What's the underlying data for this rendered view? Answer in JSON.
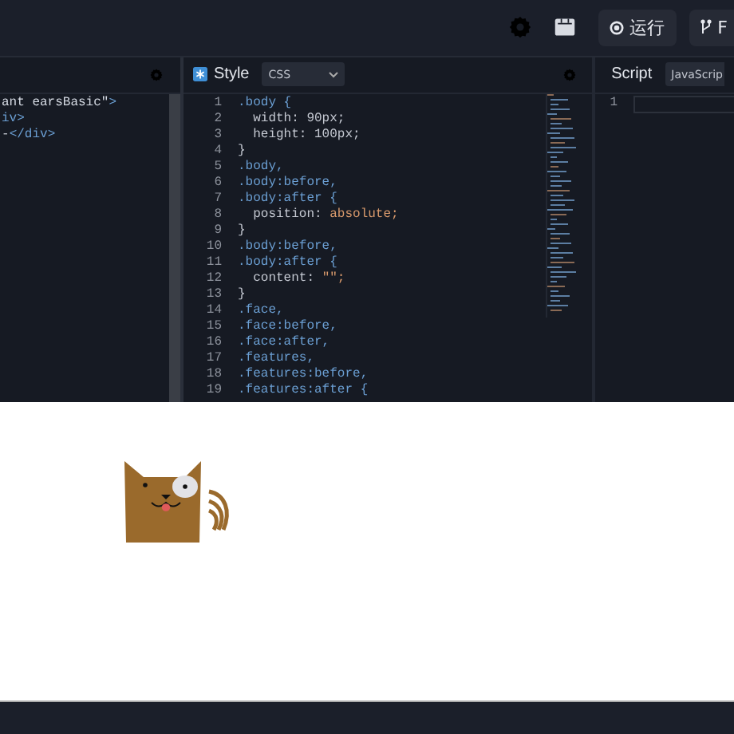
{
  "toolbar": {
    "run_button": "运行",
    "fork_button": "F"
  },
  "html_panel": {
    "lines": [
      {
        "segments": [
          {
            "text": "ant earsBasic\"",
            "kind": "string"
          },
          {
            "text": ">",
            "kind": "tag"
          }
        ]
      },
      {
        "segments": [
          {
            "text": "iv>",
            "kind": "tag"
          }
        ]
      },
      {
        "segments": [
          {
            "text": "-",
            "kind": "plain"
          },
          {
            "text": "</div>",
            "kind": "tag"
          }
        ]
      }
    ]
  },
  "style_panel": {
    "title": "Style",
    "language": "CSS",
    "lines": [
      {
        "number": "1",
        "segments": [
          {
            "text": ".body {",
            "kind": "selector"
          }
        ]
      },
      {
        "number": "2",
        "segments": [
          {
            "text": "  width: 90px;",
            "kind": "plain"
          }
        ]
      },
      {
        "number": "3",
        "segments": [
          {
            "text": "  height: 100px;",
            "kind": "plain"
          }
        ]
      },
      {
        "number": "4",
        "segments": [
          {
            "text": "}",
            "kind": "plain"
          }
        ]
      },
      {
        "number": "5",
        "segments": [
          {
            "text": ".body,",
            "kind": "selector"
          }
        ]
      },
      {
        "number": "6",
        "segments": [
          {
            "text": ".body:before,",
            "kind": "selector"
          }
        ]
      },
      {
        "number": "7",
        "segments": [
          {
            "text": ".body:after {",
            "kind": "selector"
          }
        ]
      },
      {
        "number": "8",
        "segments": [
          {
            "text": "  position: ",
            "kind": "plain"
          },
          {
            "text": "absolute;",
            "kind": "value"
          }
        ]
      },
      {
        "number": "9",
        "segments": [
          {
            "text": "}",
            "kind": "plain"
          }
        ]
      },
      {
        "number": "10",
        "segments": [
          {
            "text": ".body:before,",
            "kind": "selector"
          }
        ]
      },
      {
        "number": "11",
        "segments": [
          {
            "text": ".body:after {",
            "kind": "selector"
          }
        ]
      },
      {
        "number": "12",
        "segments": [
          {
            "text": "  content: ",
            "kind": "plain"
          },
          {
            "text": "\"\";",
            "kind": "value"
          }
        ]
      },
      {
        "number": "13",
        "segments": [
          {
            "text": "}",
            "kind": "plain"
          }
        ]
      },
      {
        "number": "14",
        "segments": [
          {
            "text": ".face,",
            "kind": "selector"
          }
        ]
      },
      {
        "number": "15",
        "segments": [
          {
            "text": ".face:before,",
            "kind": "selector"
          }
        ]
      },
      {
        "number": "16",
        "segments": [
          {
            "text": ".face:after,",
            "kind": "selector"
          }
        ]
      },
      {
        "number": "17",
        "segments": [
          {
            "text": ".features,",
            "kind": "selector"
          }
        ]
      },
      {
        "number": "18",
        "segments": [
          {
            "text": ".features:before,",
            "kind": "selector"
          }
        ]
      },
      {
        "number": "19",
        "segments": [
          {
            "text": ".features:after {",
            "kind": "selector"
          }
        ]
      }
    ]
  },
  "script_panel": {
    "title": "Script",
    "language": "JavaScrip",
    "lines": [
      {
        "number": "1"
      }
    ]
  }
}
